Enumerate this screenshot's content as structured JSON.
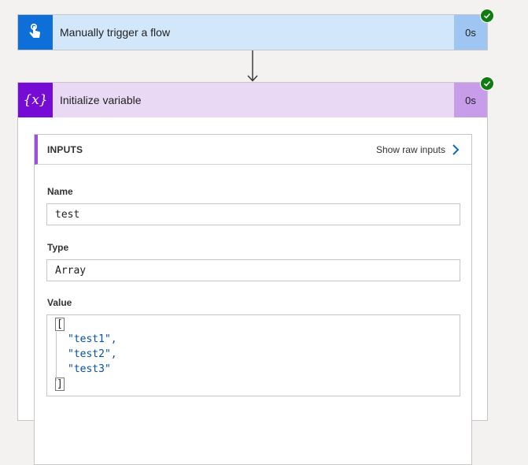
{
  "trigger": {
    "title": "Manually trigger a flow",
    "duration": "0s",
    "icon": "hand-tap-icon",
    "status": "succeeded",
    "colors": {
      "header": "#d3e7fb",
      "icon_bg": "#0f6fd8",
      "duration_bg": "#9fc6f2"
    }
  },
  "variable_action": {
    "title": "Initialize variable",
    "duration": "0s",
    "icon": "variable-icon",
    "icon_glyph": "{x}",
    "status": "succeeded",
    "colors": {
      "header": "#ead9f5",
      "icon_bg": "#770bd6",
      "duration_bg": "#c79de9"
    },
    "inputs": {
      "heading": "INPUTS",
      "raw_link": "Show raw inputs",
      "name_label": "Name",
      "name_value": "test",
      "type_label": "Type",
      "type_value": "Array",
      "value_label": "Value",
      "value_open": "[",
      "value_items": [
        "\"test1\",",
        "\"test2\",",
        "\"test3\""
      ],
      "value_close": "]"
    }
  },
  "colors": {
    "success": "#107c10",
    "link_accent": "#0f6cbd",
    "string_literal": "#0451a5"
  }
}
